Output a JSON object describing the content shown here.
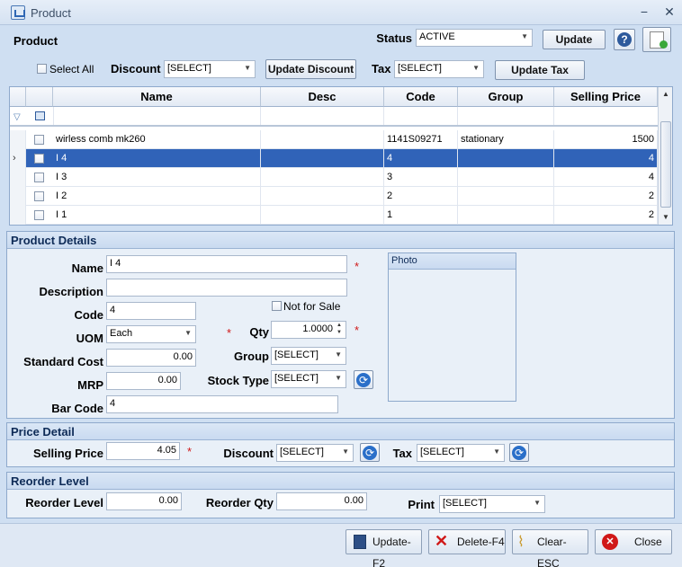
{
  "window": {
    "title": "Product"
  },
  "header": {
    "title": "Product",
    "status_label": "Status",
    "status_value": "ACTIVE",
    "update_label": "Update"
  },
  "toolbar": {
    "select_all_label": "Select All",
    "discount_label": "Discount",
    "discount_value": "[SELECT]",
    "update_discount_label": "Update Discount",
    "tax_label": "Tax",
    "tax_value": "[SELECT]",
    "update_tax_label": "Update Tax"
  },
  "grid": {
    "columns": [
      "Name",
      "Desc",
      "Code",
      "Group",
      "Selling Price"
    ],
    "rows": [
      {
        "name": "wirless comb mk260",
        "desc": "",
        "code": "1141S09271",
        "group": "stationary",
        "price": "1500"
      },
      {
        "name": "I 4",
        "desc": "",
        "code": "4",
        "group": "",
        "price": "4"
      },
      {
        "name": "I 3",
        "desc": "",
        "code": "3",
        "group": "",
        "price": "4"
      },
      {
        "name": "I 2",
        "desc": "",
        "code": "2",
        "group": "",
        "price": "2"
      },
      {
        "name": "I 1",
        "desc": "",
        "code": "1",
        "group": "",
        "price": "2"
      }
    ]
  },
  "product_details": {
    "heading": "Product Details",
    "name_label": "Name",
    "name_value": "I 4",
    "description_label": "Description",
    "description_value": "",
    "code_label": "Code",
    "code_value": "4",
    "not_for_sale_label": "Not for Sale",
    "uom_label": "UOM",
    "uom_value": "Each",
    "qty_label": "Qty",
    "qty_value": "1.0000",
    "standard_cost_label": "Standard Cost",
    "standard_cost_value": "0.00",
    "group_label": "Group",
    "group_value": "[SELECT]",
    "mrp_label": "MRP",
    "mrp_value": "0.00",
    "stock_type_label": "Stock Type",
    "stock_type_value": "[SELECT]",
    "bar_code_label": "Bar Code",
    "bar_code_value": "4",
    "photo_label": "Photo"
  },
  "price_detail": {
    "heading": "Price Detail",
    "selling_price_label": "Selling Price",
    "selling_price_value": "4.05",
    "discount_label": "Discount",
    "discount_value": "[SELECT]",
    "tax_label": "Tax",
    "tax_value": "[SELECT]"
  },
  "reorder": {
    "heading": "Reorder Level",
    "reorder_level_label": "Reorder Level",
    "reorder_level_value": "0.00",
    "reorder_qty_label": "Reorder Qty",
    "reorder_qty_value": "0.00",
    "print_label": "Print",
    "print_value": "[SELECT]"
  },
  "footer": {
    "update_label": "Update-F2",
    "delete_label": "Delete-F4",
    "clear_label": "Clear-ESC",
    "close_label": "Close"
  },
  "colors": {
    "selected_row": "#3063b8",
    "required": "#d01818",
    "section_header": "#c9daf0"
  }
}
